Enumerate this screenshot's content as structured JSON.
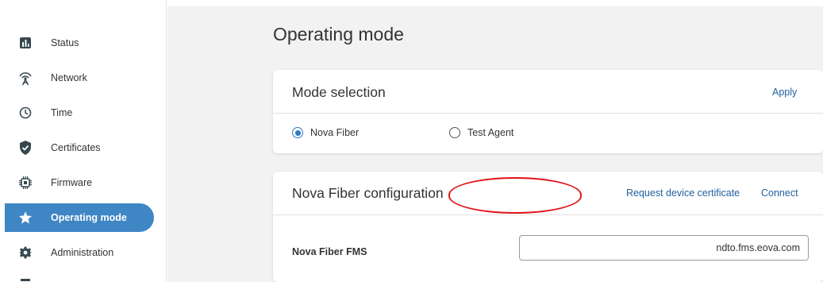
{
  "sidebar": {
    "items": [
      {
        "label": "Status",
        "icon": "bar-chart-icon",
        "active": false
      },
      {
        "label": "Network",
        "icon": "antenna-icon",
        "active": false
      },
      {
        "label": "Time",
        "icon": "clock-icon",
        "active": false
      },
      {
        "label": "Certificates",
        "icon": "shield-check-icon",
        "active": false
      },
      {
        "label": "Firmware",
        "icon": "chip-icon",
        "active": false
      },
      {
        "label": "Operating mode",
        "icon": "star-icon",
        "active": true
      },
      {
        "label": "Administration",
        "icon": "gear-icon",
        "active": false
      }
    ]
  },
  "page": {
    "title": "Operating mode"
  },
  "mode_card": {
    "title": "Mode selection",
    "apply_label": "Apply",
    "options": [
      {
        "label": "Nova Fiber",
        "selected": true
      },
      {
        "label": "Test Agent",
        "selected": false
      }
    ]
  },
  "config_card": {
    "title": "Nova Fiber configuration",
    "request_cert_label": "Request device certificate",
    "connect_label": "Connect",
    "fms_label": "Nova Fiber FMS",
    "fms_value": "ndto.fms.eova.com"
  },
  "colors": {
    "accent": "#3f86c5",
    "link": "#1f5f9e",
    "highlight": "#e0131a",
    "background": "#f2f2f2"
  }
}
